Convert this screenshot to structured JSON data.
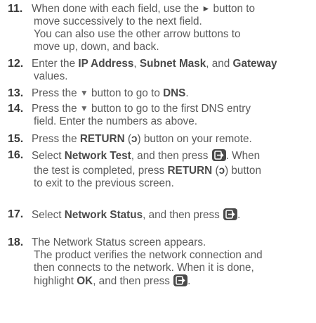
{
  "steps": [
    {
      "number": "11.",
      "lines": {
        "l1a": "When done with each field, use the ",
        "l1b": " button to",
        "l2": "move successively to the next field.",
        "l3": "You can also use the other arrow buttons to",
        "l4": "move up, down, and back."
      }
    },
    {
      "number": "12.",
      "lines": {
        "l1a": "Enter the ",
        "ip": "IP Address",
        "sep1": ", ",
        "subnet": "Subnet Mask",
        "sep2": ", and ",
        "gateway": "Gateway",
        "l2": "values."
      }
    },
    {
      "number": "13.",
      "lines": {
        "l1a": "Press the ",
        "l1b": " button to go to ",
        "dns": "DNS",
        "l1c": "."
      }
    },
    {
      "number": "14.",
      "lines": {
        "l1a": "Press the ",
        "l1b": " button to go to the first DNS entry",
        "l2": "field. Enter the numbers as above."
      }
    },
    {
      "number": "15.",
      "lines": {
        "l1a": "Press the ",
        "ret": "RETURN",
        "l1b": " (",
        "l1c": ") button on your remote."
      }
    },
    {
      "number": "16.",
      "lines": {
        "l1a": "Select ",
        "nt": "Network Test",
        "l1b": ", and then press ",
        "l1c": ". When",
        "l2a": "the test is completed, press ",
        "ret": "RETURN",
        "l2b": " (",
        "l2c": ") button",
        "l3": "to exit to the previous screen."
      }
    },
    {
      "number": "17.",
      "lines": {
        "l1a": "Select ",
        "ns": "Network Status",
        "l1b": ", and then press ",
        "l1c": "."
      }
    },
    {
      "number": "18.",
      "lines": {
        "l1": "The Network Status screen appears.",
        "l2": "The product verifies the network connection and",
        "l3": "then connects to the network. When it is done,",
        "l4a": "highlight ",
        "ok": "OK",
        "l4b": ", and then press ",
        "l4c": "."
      }
    }
  ],
  "icons": {
    "right_arrow": "►",
    "down_arrow": "▼",
    "return_symbol": "ↄ",
    "enter_button": "enter-icon"
  }
}
